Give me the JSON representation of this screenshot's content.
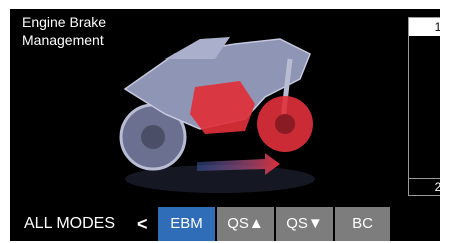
{
  "header": {
    "title_line1": "Engine Brake",
    "title_line2": "Management"
  },
  "level_bar": {
    "top_label": "1",
    "bottom_label": "2"
  },
  "footer": {
    "all_modes": "ALL MODES",
    "back_arrow": "<"
  },
  "tabs": [
    {
      "label": "EBM",
      "active": true
    },
    {
      "label": "QS▲",
      "active": false
    },
    {
      "label": "QS▼",
      "active": false
    },
    {
      "label": "BC",
      "active": false
    }
  ],
  "colors": {
    "active_tab": "#2f6db8",
    "inactive_tab": "#7d7d7d",
    "engine_highlight": "#e0303a",
    "bike_body": "#8f95b5"
  },
  "icons": {
    "back": "chevron-left-icon",
    "illustration": "motorcycle-illustration"
  }
}
